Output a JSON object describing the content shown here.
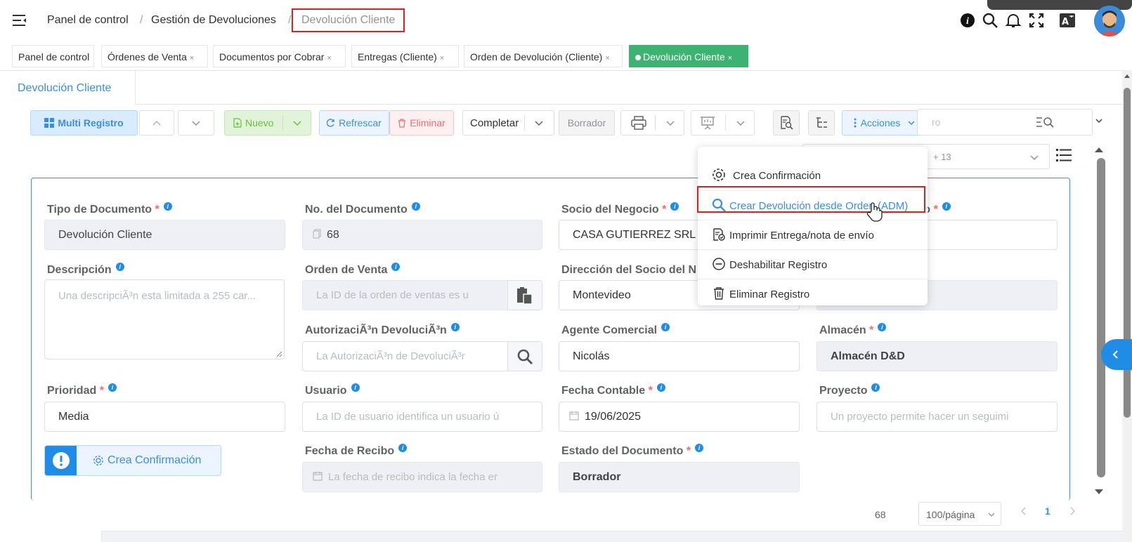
{
  "breadcrumb": {
    "items": [
      "Panel de control",
      "Gestión de Devoluciones"
    ],
    "separator": "/",
    "active": "Devolución Cliente"
  },
  "tabs": [
    {
      "label": "Panel de control",
      "close": "×"
    },
    {
      "label": "Órdenes de Venta",
      "close": "×"
    },
    {
      "label": "Documentos por Cobrar",
      "close": "×"
    },
    {
      "label": "Entregas (Cliente)",
      "close": "×"
    },
    {
      "label": "Orden de Devolución (Cliente)",
      "close": "×"
    },
    {
      "label": "Devolución Cliente",
      "close": "×"
    }
  ],
  "subtab": {
    "label": "Devolución Cliente"
  },
  "toolbar": {
    "multi_registro": "Multi Registro",
    "nuevo": "Nuevo",
    "refrescar": "Refrescar",
    "eliminar": "Eliminar",
    "completar": "Completar",
    "borrador": "Borrador",
    "acciones": "Acciones",
    "search_partial": "ro",
    "select_partial": "+ 13"
  },
  "actions_menu": {
    "items": [
      {
        "label": "Crea Confirmación",
        "icon": "gear-icon"
      },
      {
        "label": "Crear Devolución desde Orden (ADM)",
        "icon": "search-icon"
      },
      {
        "label": "Imprimir Entrega/nota de envío",
        "icon": "print-check-icon"
      },
      {
        "label": "Deshabilitar Registro",
        "icon": "minus-circle-icon"
      },
      {
        "label": "Eliminar Registro",
        "icon": "trash-icon"
      }
    ]
  },
  "form": {
    "tipo_documento": {
      "label": "Tipo de Documento",
      "value": "Devolución  Cliente"
    },
    "no_documento": {
      "label": "No. del Documento",
      "value": "68"
    },
    "socio_negocio": {
      "label": "Socio del Negocio",
      "value": "CASA GUTIERREZ SRL"
    },
    "col4_label_tail": "to",
    "descripcion": {
      "label": "Descripción",
      "placeholder": "Una descripciÃ³n esta limitada a 255 car..."
    },
    "orden_venta": {
      "label": "Orden de Venta",
      "placeholder": "La ID de la orden de ventas es u"
    },
    "direccion_socio": {
      "label": "Dirección del Socio del N",
      "value": "Montevideo"
    },
    "autorizacion": {
      "label": "AutorizaciÃ³n DevoluciÃ³n",
      "placeholder": "La AutorizaciÃ³n de DevoluciÃ³r"
    },
    "agente": {
      "label": "Agente Comercial",
      "value": "Nicolás"
    },
    "almacen": {
      "label": "Almacén",
      "value": "Almacén D&D"
    },
    "prioridad": {
      "label": "Prioridad",
      "value": "Media"
    },
    "usuario": {
      "label": "Usuario",
      "placeholder": "La ID de usuario identifica un usuario ú"
    },
    "fecha_contable": {
      "label": "Fecha Contable",
      "value": "19/06/2025"
    },
    "proyecto": {
      "label": "Proyecto",
      "placeholder": "Un proyecto permite hacer un seguimi"
    },
    "crea_confirmacion": "Crea Confirmación",
    "fecha_recibo": {
      "label": "Fecha de Recibo",
      "placeholder": "La fecha de recibo indica la fecha er"
    },
    "estado_documento": {
      "label": "Estado del Documento",
      "value": "Borrador"
    },
    "required_mark": "*",
    "info_mark": "i"
  },
  "pager": {
    "total": "68",
    "page_size": "100/página",
    "current": "1"
  },
  "colors": {
    "primary": "#3a8ee6",
    "success": "#3cb371",
    "danger": "#f56c6c",
    "highlight": "#e02020"
  }
}
